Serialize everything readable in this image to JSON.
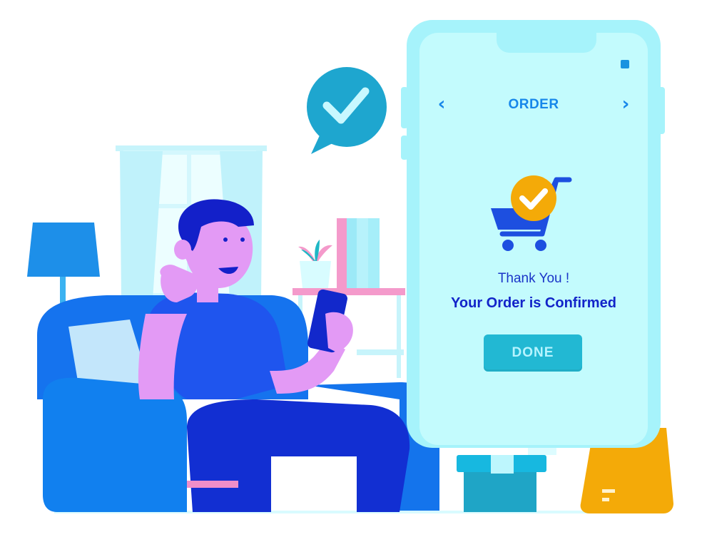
{
  "phone_screen": {
    "title": "ORDER",
    "prev_icon": "chevron-left-icon",
    "next_icon": "chevron-right-icon",
    "prev_glyph": "‹",
    "next_glyph": "›",
    "cart_icon": "shopping-cart-check-icon",
    "thanks_text": "Thank You !",
    "confirmation_text": "Your Order is Confirmed",
    "done_label": "DONE"
  },
  "colors": {
    "phone_frame": "#a6f3fb",
    "screen": "#c3fbfd",
    "accent_blue": "#1787ea",
    "text_blue": "#1224c9",
    "button": "#22b8d3",
    "check_badge": "#f4aa08",
    "bubble": "#1ea6cf",
    "sofa": "#1573ee",
    "bag": "#f4aa08"
  },
  "illustration": {
    "speech_bubble_icon": "check-speech-bubble-icon",
    "shopping_bag_icon": "shopping-bag-icon",
    "box_icon": "package-box-icon",
    "lamp_icon": "floor-lamp-icon",
    "plant_icon": "potted-plant-icon",
    "person": "man-on-sofa-illustration"
  }
}
